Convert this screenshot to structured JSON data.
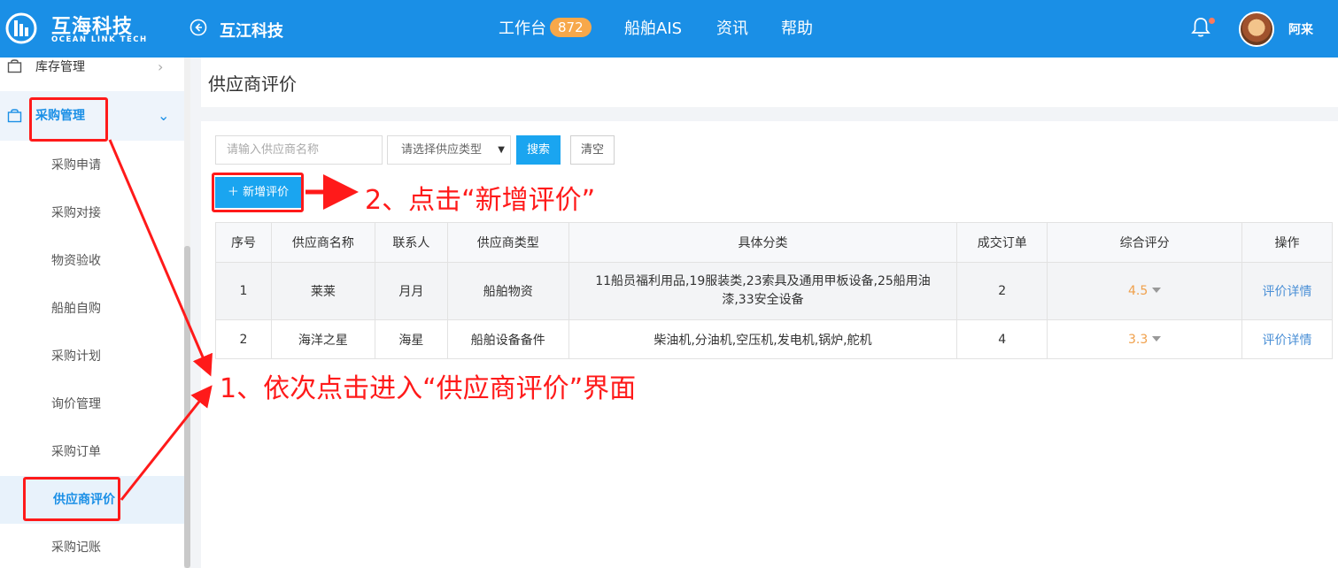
{
  "header": {
    "logo_cn": "互海科技",
    "logo_en": "OCEAN LINK TECH",
    "company": "互江科技",
    "nav": {
      "workbench": "工作台",
      "workbench_badge": "872",
      "ais": "船舶AIS",
      "news": "资讯",
      "help": "帮助"
    },
    "username": "阿来"
  },
  "sidebar": {
    "inventory": "库存管理",
    "purchase": "采购管理",
    "items": [
      "采购申请",
      "采购对接",
      "物资验收",
      "船舶自购",
      "采购计划",
      "询价管理",
      "采购订单",
      "供应商评价",
      "采购记账"
    ]
  },
  "page": {
    "title": "供应商评价"
  },
  "filters": {
    "search_placeholder": "请输入供应商名称",
    "type_placeholder": "请选择供应类型",
    "search_btn": "搜索",
    "clear_btn": "清空",
    "add_btn": "新增评价"
  },
  "table": {
    "headers": [
      "序号",
      "供应商名称",
      "联系人",
      "供应商类型",
      "具体分类",
      "成交订单",
      "综合评分",
      "操作"
    ],
    "rows": [
      {
        "no": "1",
        "name": "莱莱",
        "contact": "月月",
        "type": "船舶物资",
        "category_line1": "11船员福利用品,19服装类,23索具及通用甲板设备,25船用油",
        "category_line2": "漆,33安全设备",
        "orders": "2",
        "score": "4.5",
        "action": "评价详情"
      },
      {
        "no": "2",
        "name": "海洋之星",
        "contact": "海星",
        "type": "船舶设备备件",
        "category_line1": "柴油机,分油机,空压机,发电机,锅炉,舵机",
        "orders": "4",
        "score": "3.3",
        "action": "评价详情"
      }
    ]
  },
  "annotations": {
    "step1": "1、依次点击进入“供应商评价”界面",
    "step2": "2、点击“新增评价”"
  },
  "colors": {
    "header_bg": "#1a8fe6",
    "primary_button": "#1aa5f0",
    "score": "#f0a04b",
    "annotation": "#ff1a1a"
  }
}
